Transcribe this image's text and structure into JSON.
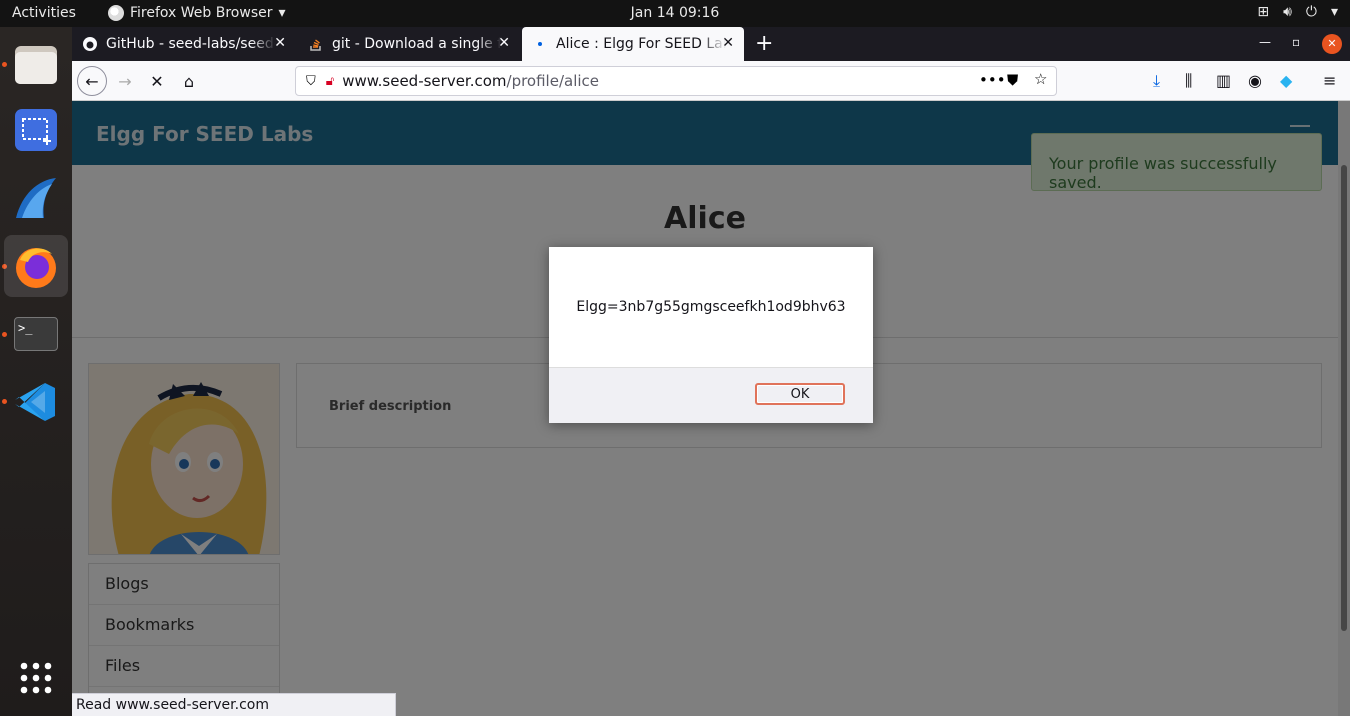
{
  "topbar": {
    "activities": "Activities",
    "app_name": "Firefox Web Browser",
    "clock": "Jan 14  09:16"
  },
  "dock": {
    "items": [
      "files",
      "screenshot",
      "wireshark",
      "firefox",
      "terminal",
      "vscode",
      "show-apps"
    ],
    "terminal_prompt": ">_"
  },
  "tabs": [
    {
      "label": "GitHub - seed-labs/seed-labs",
      "icon": "github-icon"
    },
    {
      "label": "git - Download a single file",
      "icon": "stackoverflow-icon"
    },
    {
      "label": "Alice : Elgg For SEED Labs",
      "icon": "loading-dot-icon",
      "active": true
    }
  ],
  "navbar": {
    "url_host": "www.seed-server.com",
    "url_path": "/profile/alice"
  },
  "page": {
    "site_title": "Elgg For SEED Labs",
    "profile_name": "Alice",
    "brief_description_label": "Brief description",
    "menu": [
      "Blogs",
      "Bookmarks",
      "Files"
    ],
    "toast": "Your profile was successfully saved."
  },
  "dialog": {
    "message": "Elgg=3nb7g55gmgsceefkh1od9bhv63",
    "ok_label": "OK"
  },
  "statusbar": {
    "text": "Read www.seed-server.com"
  },
  "colors": {
    "elgg_header": "#1d6f93",
    "accent": "#e95420",
    "toast_bg": "#dff0d8"
  }
}
